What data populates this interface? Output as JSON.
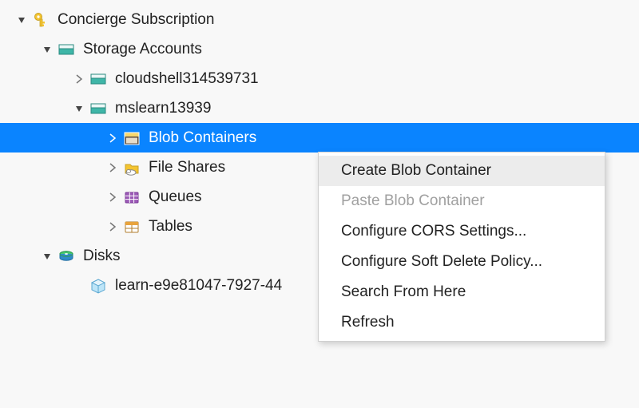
{
  "tree": {
    "subscription": "Concierge Subscription",
    "storage_accounts": "Storage Accounts",
    "acct1": "cloudshell314539731",
    "acct2": "mslearn13939",
    "blob_containers": "Blob Containers",
    "file_shares": "File Shares",
    "queues": "Queues",
    "tables": "Tables",
    "disks": "Disks",
    "disk1": "learn-e9e81047-7927-44"
  },
  "menu": {
    "create": "Create Blob Container",
    "paste": "Paste Blob Container",
    "cors": "Configure CORS Settings...",
    "softdelete": "Configure Soft Delete Policy...",
    "search": "Search From Here",
    "refresh": "Refresh"
  }
}
